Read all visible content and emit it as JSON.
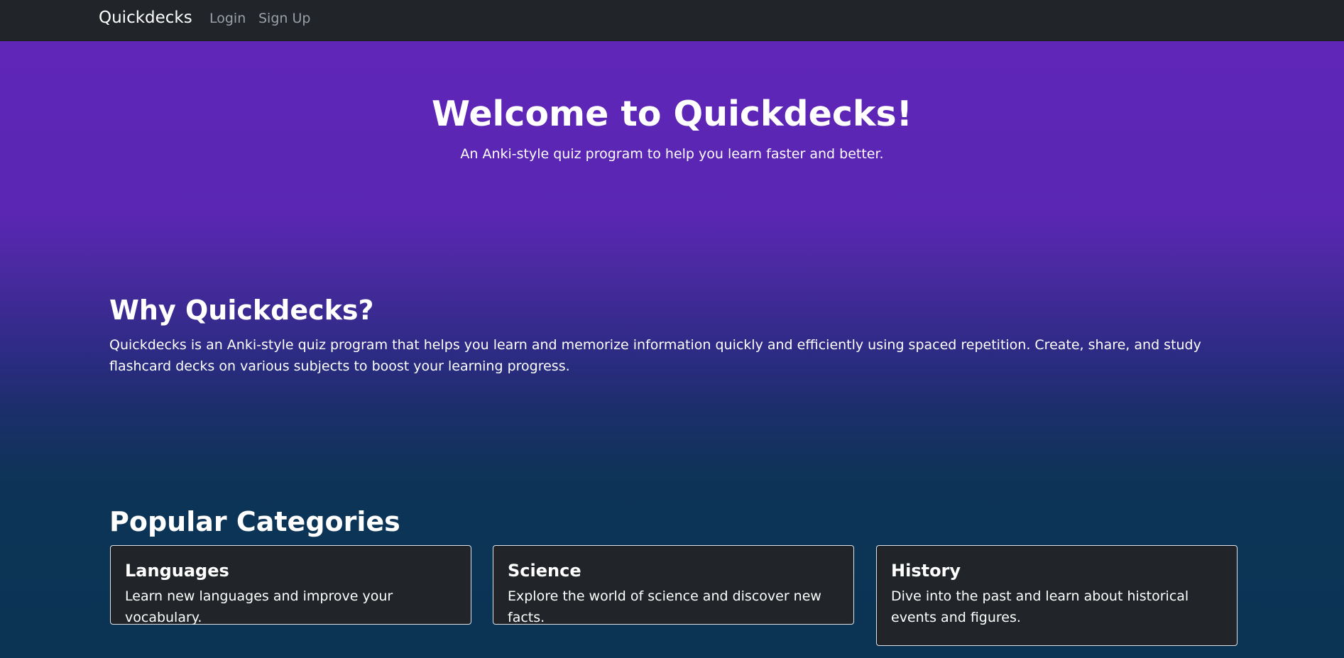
{
  "navbar": {
    "brand": "Quickdecks",
    "links": [
      {
        "label": "Login"
      },
      {
        "label": "Sign Up"
      }
    ]
  },
  "hero": {
    "title": "Welcome to Quickdecks!",
    "subtitle": "An Anki-style quiz program to help you learn faster and better."
  },
  "why": {
    "title": "Why Quickdecks?",
    "body": "Quickdecks is an Anki-style quiz program that helps you learn and memorize information quickly and efficiently using spaced repetition. Create, share, and study flashcard decks on various subjects to boost your learning progress."
  },
  "categories": {
    "title": "Popular Categories",
    "items": [
      {
        "title": "Languages",
        "text": "Learn new languages and improve your vocabulary."
      },
      {
        "title": "Science",
        "text": "Explore the world of science and discover new facts."
      },
      {
        "title": "History",
        "text": "Dive into the past and learn about historical events and figures."
      }
    ]
  },
  "colors": {
    "navbar_bg": "#212529",
    "hero_purple": "#5f26b7",
    "bottom_navy": "#0a3354",
    "card_bg": "#212529"
  }
}
